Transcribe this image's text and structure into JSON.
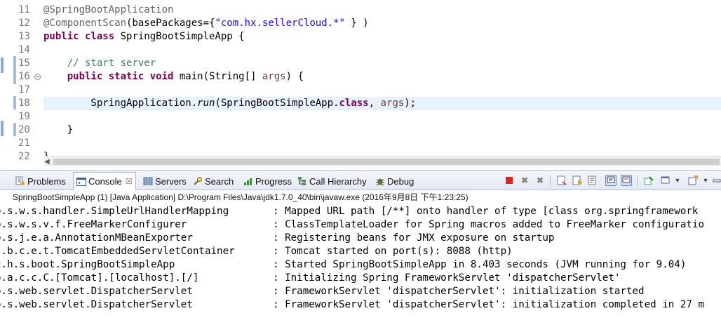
{
  "editor": {
    "lines": [
      {
        "num": "11",
        "segments": [
          {
            "t": "@SpringBootApplication",
            "c": "ann"
          }
        ]
      },
      {
        "num": "12",
        "segments": [
          {
            "t": "@ComponentScan",
            "c": "ann"
          },
          {
            "t": "(basePackages={",
            "c": ""
          },
          {
            "t": "\"com.hx.sellerCloud.*\"",
            "c": "str"
          },
          {
            "t": " } )",
            "c": ""
          }
        ]
      },
      {
        "num": "13",
        "segments": [
          {
            "t": "public class",
            "c": "kw"
          },
          {
            "t": " SpringBootSimpleApp {",
            "c": ""
          }
        ]
      },
      {
        "num": "14",
        "segments": []
      },
      {
        "num": "15",
        "segments": [
          {
            "t": "    // start server",
            "c": "com"
          }
        ]
      },
      {
        "num": "16",
        "segments": [
          {
            "t": "    ",
            "c": ""
          },
          {
            "t": "public static void",
            "c": "kw"
          },
          {
            "t": " main(String[] ",
            "c": ""
          },
          {
            "t": "args",
            "c": "par"
          },
          {
            "t": ") {",
            "c": ""
          }
        ]
      },
      {
        "num": "17",
        "segments": []
      },
      {
        "num": "18",
        "segments": [
          {
            "t": "        SpringApplication.",
            "c": ""
          },
          {
            "t": "run",
            "c": "it"
          },
          {
            "t": "(SpringBootSimpleApp.",
            "c": ""
          },
          {
            "t": "class",
            "c": "kw"
          },
          {
            "t": ", ",
            "c": ""
          },
          {
            "t": "args",
            "c": "par"
          },
          {
            "t": ");",
            "c": ""
          }
        ]
      },
      {
        "num": "19",
        "segments": []
      },
      {
        "num": "20",
        "segments": [
          {
            "t": "    }",
            "c": ""
          }
        ]
      },
      {
        "num": "21",
        "segments": []
      },
      {
        "num": "22",
        "segments": [
          {
            "t": "}",
            "c": ""
          }
        ]
      }
    ]
  },
  "tabs": {
    "problems": "Problems",
    "console": "Console",
    "console_close": "☒",
    "servers": "Servers",
    "search": "Search",
    "progress": "Progress",
    "call_hierarchy": "Call Hierarchy",
    "debug": "Debug"
  },
  "toolbar_icons": [
    "terminate-icon",
    "remove-launch-icon",
    "remove-all-icon",
    "clear-console-icon",
    "scroll-lock-icon",
    "word-wrap-icon",
    "show-on-stdout-icon",
    "show-on-stderr-icon",
    "pin-console-icon",
    "display-console-icon",
    "open-console-icon",
    "minimize-icon",
    "maximize-icon"
  ],
  "console": {
    "header": "SpringBootSimpleApp (1) [Java Application] D:\\Program Files\\Java\\jdk1.7.0_40\\bin\\javaw.exe (2016年9月8日 下午1:23:25)",
    "logs": [
      {
        "logger": "o.s.w.s.handler.SimpleUrlHandlerMapping",
        "msg": ": Mapped URL path [/**] onto handler of type [class org.springframework"
      },
      {
        "logger": "o.s.w.s.v.f.FreeMarkerConfigurer",
        "msg": ": ClassTemplateLoader for Spring macros added to FreeMarker configuratio"
      },
      {
        "logger": "o.s.j.e.a.AnnotationMBeanExporter",
        "msg": ": Registering beans for JMX exposure on startup"
      },
      {
        "logger": "s.b.c.e.t.TomcatEmbeddedServletContainer",
        "msg": ": Tomcat started on port(s): 8088 (http)"
      },
      {
        "logger": "c.h.s.boot.SpringBootSimpleApp",
        "msg": ": Started SpringBootSimpleApp in 8.403 seconds (JVM running for 9.04)"
      },
      {
        "logger": "o.a.c.c.C.[Tomcat].[localhost].[/]",
        "msg": ": Initializing Spring FrameworkServlet 'dispatcherServlet'"
      },
      {
        "logger": "o.s.web.servlet.DispatcherServlet",
        "msg": ": FrameworkServlet 'dispatcherServlet': initialization started"
      },
      {
        "logger": "o.s.web.servlet.DispatcherServlet",
        "msg": ": FrameworkServlet 'dispatcherServlet': initialization completed in 27 m"
      }
    ]
  },
  "colors": {
    "keyword": "#7f0055",
    "annotation": "#646464",
    "string": "#2a00ff",
    "comment": "#3f7f5f",
    "parameter": "#6a3e3e",
    "current_line": "#e8f2fe"
  }
}
